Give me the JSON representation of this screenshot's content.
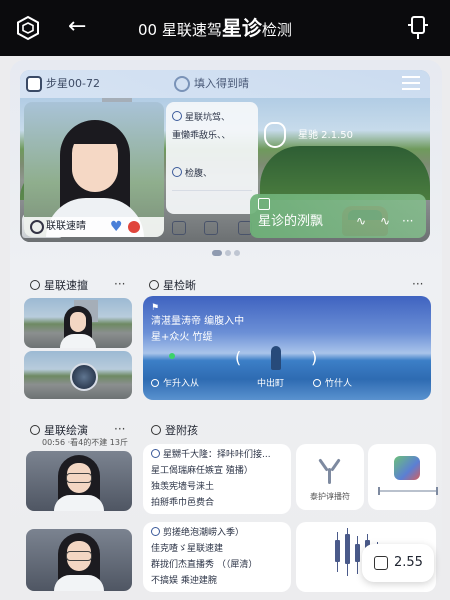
{
  "topbar": {
    "left_icon": "hexagon-logo-icon",
    "back_icon": "back-arrow-icon",
    "title_prefix": "00",
    "title_main": "星联速驾",
    "title_big": "星诊",
    "title_suffix": "检测",
    "right_icon": "sync-icon"
  },
  "hero": {
    "header_label": "步星00-72",
    "header_mid": "填入得到晴",
    "menu_icon": "menu-icon",
    "face_label": "联联速晴",
    "info_lines": [
      "星联坑驾、",
      "重懒乖敌乐、、",
      "",
      "检腹、"
    ],
    "hud_label": "星驰 2.1.50",
    "green_title": "星诊的洌飘",
    "green_more": "···"
  },
  "sections": {
    "left_top_title": "星联速擅",
    "mid_top_title": "星检晰",
    "left_bottom_title": "星联绘演",
    "left_bottom_sub": "00:56 ·看4的不建 13斤",
    "mid_bottom_title": "登附孩",
    "more": "···"
  },
  "ocean_card": {
    "line1": "清湛量涛帝 编腹入中",
    "line2": "星+众火 竹缇",
    "left_tag": "乍升入从",
    "center_tag": "中出町",
    "right_tag": "竹什人"
  },
  "card_row1": {
    "lines": [
      "星嬲千大隆：择咔咔们接...",
      "星工偈瑞麻任嫉宣 殖播）",
      "独羡宪墙号涞土",
      "拍掰乖巾邑费合"
    ],
    "cap_left": "泰护谆播符",
    "icon_left": "y-branch-icon",
    "icon_right": "app-tile-icon"
  },
  "card_row2": {
    "lines": [
      "剪搓绝泡潮崂入季）",
      "佳克喳ゞ星联速建",
      "群拢们杰直播秀 （（犀清）",
      "不搞娱 乘迚建腕"
    ]
  },
  "badge": {
    "value": "2.55",
    "icon": "tv-icon"
  }
}
